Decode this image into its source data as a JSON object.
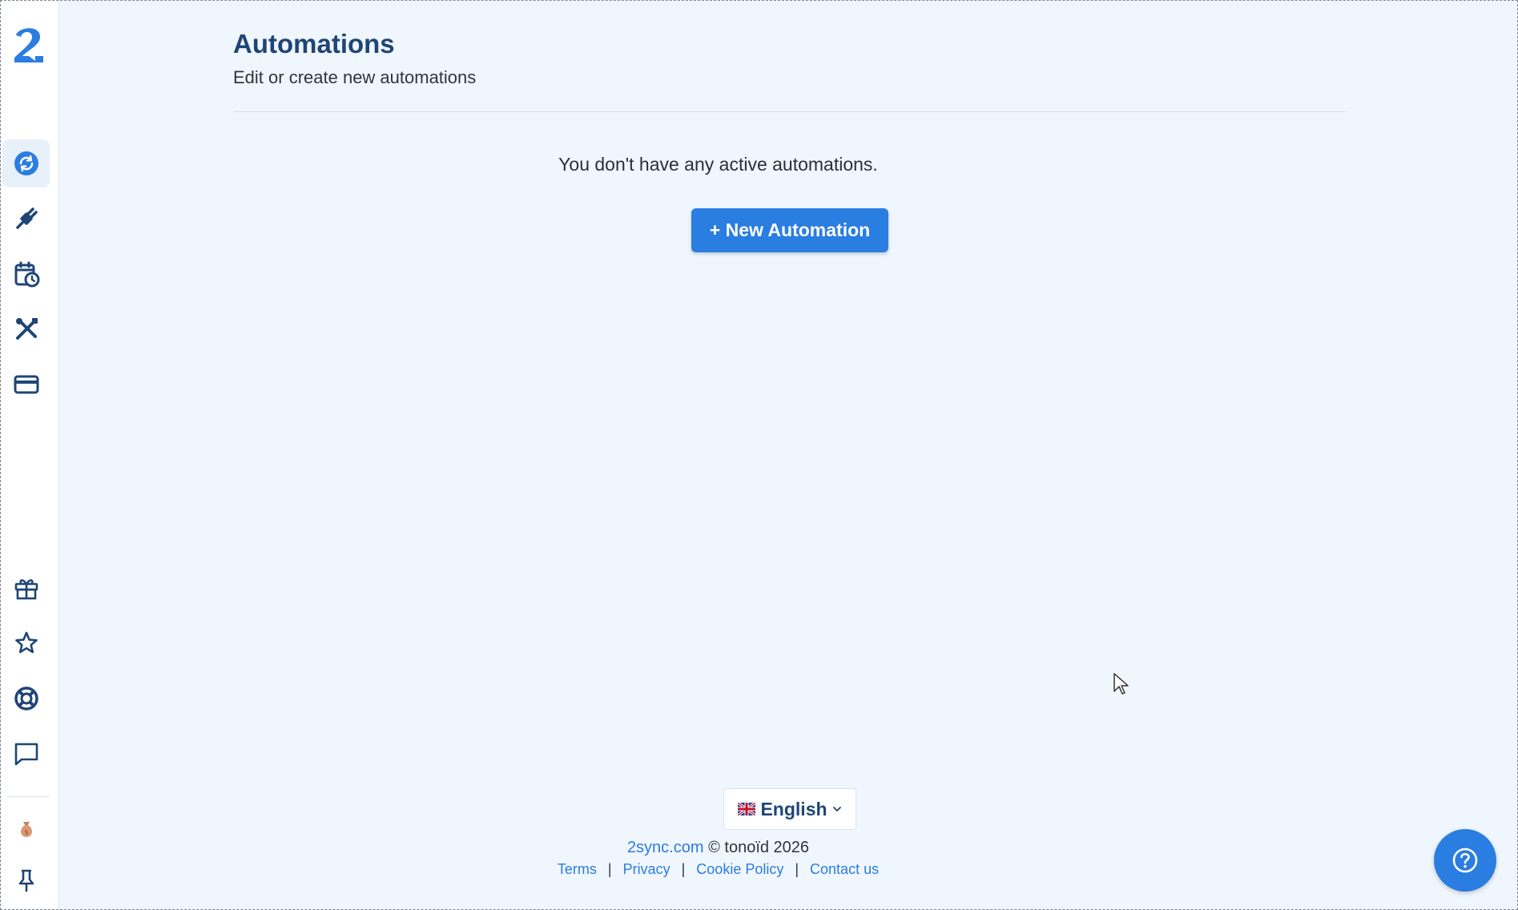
{
  "sidebar": {
    "logo": "2sync-logo",
    "nav_top": [
      {
        "icon": "sync-icon",
        "active": true
      },
      {
        "icon": "plug-icon"
      },
      {
        "icon": "calendar-clock-icon"
      },
      {
        "icon": "tools-icon"
      },
      {
        "icon": "credit-card-icon"
      }
    ],
    "nav_bottom": [
      {
        "icon": "gift-icon"
      },
      {
        "icon": "star-icon"
      },
      {
        "icon": "lifebuoy-icon"
      },
      {
        "icon": "chat-icon"
      },
      {
        "icon": "money-bag-icon"
      },
      {
        "icon": "pin-icon"
      }
    ]
  },
  "header": {
    "title": "Automations",
    "subtitle": "Edit or create new automations"
  },
  "main": {
    "empty_message": "You don't have any active automations.",
    "new_button_label": "+ New Automation"
  },
  "footer": {
    "language": "English",
    "language_flag": "uk-flag-icon",
    "site_link": "2sync.com",
    "copyright": "© tonoïd 2026",
    "links": {
      "terms": "Terms",
      "privacy": "Privacy",
      "cookie_policy": "Cookie Policy",
      "contact": "Contact us"
    },
    "separator": "|"
  },
  "colors": {
    "accent": "#2a7de1",
    "navy": "#1f4576",
    "background": "#f0f6fd"
  }
}
